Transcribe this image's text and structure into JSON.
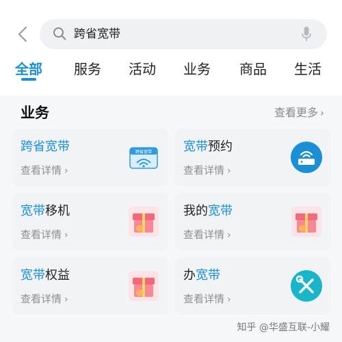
{
  "search": {
    "query": "跨省宽带"
  },
  "tabs": [
    {
      "label": "全部",
      "active": true
    },
    {
      "label": "服务",
      "active": false
    },
    {
      "label": "活动",
      "active": false
    },
    {
      "label": "业务",
      "active": false
    },
    {
      "label": "商品",
      "active": false
    },
    {
      "label": "生活",
      "active": false
    }
  ],
  "section": {
    "title": "业务",
    "more_label": "查看更多"
  },
  "cards": [
    {
      "title_pre": "",
      "title_hl": "跨省宽带",
      "title_post": "",
      "sub": "查看详情",
      "icon_text": "跨省宽带"
    },
    {
      "title_pre": "",
      "title_hl": "宽带",
      "title_post": "预约",
      "sub": "查看详情"
    },
    {
      "title_pre": "",
      "title_hl": "宽带",
      "title_post": "移机",
      "sub": "查看详情"
    },
    {
      "title_pre": "我的",
      "title_hl": "宽带",
      "title_post": "",
      "sub": "查看详情"
    },
    {
      "title_pre": "",
      "title_hl": "宽带",
      "title_post": "权益",
      "sub": "查看详情"
    },
    {
      "title_pre": "办",
      "title_hl": "宽带",
      "title_post": "",
      "sub": "查看详情"
    }
  ],
  "watermark": "知乎 @华盛互联-小耀",
  "colors": {
    "accent": "#1a8fd6",
    "muted": "#8e8e8e"
  }
}
